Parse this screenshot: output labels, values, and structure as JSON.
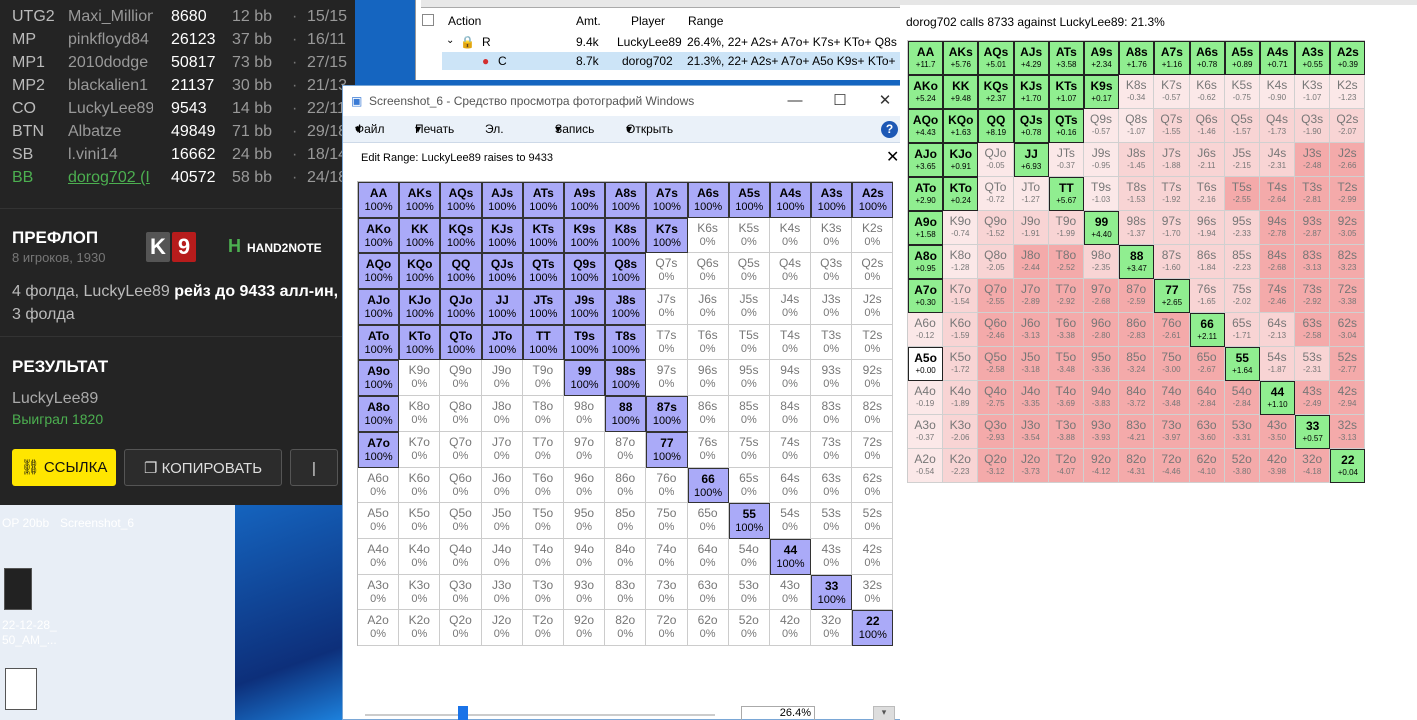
{
  "desktop": {
    "icons": [
      {
        "label": "OP 20bb"
      },
      {
        "label": "Screenshot_6"
      },
      {
        "label": "22-12-28_ 50_AM_..."
      }
    ]
  },
  "panel": {
    "seats": [
      {
        "pos": "UTG2",
        "name": "Maxi_Million",
        "stack": "8680",
        "bb": "12 bb",
        "cards": "15/15"
      },
      {
        "pos": "MP",
        "name": "pinkfloyd84",
        "stack": "26123",
        "bb": "37 bb",
        "cards": "16/11"
      },
      {
        "pos": "MP1",
        "name": "2010dodge",
        "stack": "50817",
        "bb": "73 bb",
        "cards": "27/15"
      },
      {
        "pos": "MP2",
        "name": "blackalien1",
        "stack": "21137",
        "bb": "30 bb",
        "cards": "21/13"
      },
      {
        "pos": "CO",
        "name": "LuckyLee89",
        "stack": "9543",
        "bb": "14 bb",
        "cards": "22/11"
      },
      {
        "pos": "BTN",
        "name": "Albatze",
        "stack": "49849",
        "bb": "71 bb",
        "cards": "29/18"
      },
      {
        "pos": "SB",
        "name": "l.vini14",
        "stack": "16662",
        "bb": "24 bb",
        "cards": "18/14"
      },
      {
        "pos": "BB",
        "name": "dorog702 (I",
        "stack": "40572",
        "bb": "58 bb",
        "cards": "24/18"
      }
    ],
    "dot": "·",
    "preflop_title": "ПРЕФЛОП",
    "preflop_sub": "8 игроков, 1930",
    "card1": "K",
    "card2": "9",
    "brand": "HAND2NOTE",
    "action_pre": "4 фолда, LuckyLee89 ",
    "action_bold": "рейз до 9433 алл-ин,",
    "action_post": "3 фолда",
    "result_title": "РЕЗУЛЬТАТ",
    "winner": "LuckyLee89",
    "won": "Выиграл 1820",
    "btn_link": "ССЫЛКА",
    "btn_copy": "КОПИРОВАТЬ",
    "btn_more": "|"
  },
  "history": {
    "headers": {
      "action": "Action",
      "amt": "Amt.",
      "player": "Player",
      "range": "Range"
    },
    "rows": [
      {
        "action": "R",
        "amt": "9.4k",
        "player": "LuckyLee89",
        "range": "26.4%, 22+ A2s+ A7o+ K7s+ KTo+ Q8s"
      },
      {
        "action": "C",
        "amt": "8.7k",
        "player": "dorog702",
        "range": "21.3%, 22+ A2s+ A7o+ A5o K9s+ KTo+"
      }
    ]
  },
  "viewer": {
    "title": "Screenshot_6 - Средство просмотра фотографий Windows",
    "menu": {
      "file": "Файл",
      "print": "Печать",
      "email": "Эл. почта",
      "record": "Запись",
      "open": "Открыть",
      "help": "?"
    },
    "edit_title": "Edit Range: LuckyLee89 raises to 9433",
    "close": "✕",
    "pct": "26.4%",
    "dd": "▾",
    "min": "—",
    "max": "☐",
    "xclose": "✕",
    "hands": [
      "AA",
      "AKs",
      "AQs",
      "AJs",
      "ATs",
      "A9s",
      "A8s",
      "A7s",
      "A6s",
      "A5s",
      "A4s",
      "A3s",
      "A2s",
      "AKo",
      "KK",
      "KQs",
      "KJs",
      "KTs",
      "K9s",
      "K8s",
      "K7s",
      "K6s",
      "K5s",
      "K4s",
      "K3s",
      "K2s",
      "AQo",
      "KQo",
      "QQ",
      "QJs",
      "QTs",
      "Q9s",
      "Q8s",
      "Q7s",
      "Q6s",
      "Q5s",
      "Q4s",
      "Q3s",
      "Q2s",
      "AJo",
      "KJo",
      "QJo",
      "JJ",
      "JTs",
      "J9s",
      "J8s",
      "J7s",
      "J6s",
      "J5s",
      "J4s",
      "J3s",
      "J2s",
      "ATo",
      "KTo",
      "QTo",
      "JTo",
      "TT",
      "T9s",
      "T8s",
      "T7s",
      "T6s",
      "T5s",
      "T4s",
      "T3s",
      "T2s",
      "A9o",
      "K9o",
      "Q9o",
      "J9o",
      "T9o",
      "99",
      "98s",
      "97s",
      "96s",
      "95s",
      "94s",
      "93s",
      "92s",
      "A8o",
      "K8o",
      "Q8o",
      "J8o",
      "T8o",
      "98o",
      "88",
      "87s",
      "86s",
      "85s",
      "84s",
      "83s",
      "82s",
      "A7o",
      "K7o",
      "Q7o",
      "J7o",
      "T7o",
      "97o",
      "87o",
      "77",
      "76s",
      "75s",
      "74s",
      "73s",
      "72s",
      "A6o",
      "K6o",
      "Q6o",
      "J6o",
      "T6o",
      "96o",
      "86o",
      "76o",
      "66",
      "65s",
      "64s",
      "63s",
      "62s",
      "A5o",
      "K5o",
      "Q5o",
      "J5o",
      "T5o",
      "95o",
      "85o",
      "75o",
      "65o",
      "55",
      "54s",
      "53s",
      "52s",
      "A4o",
      "K4o",
      "Q4o",
      "J4o",
      "T4o",
      "94o",
      "84o",
      "74o",
      "64o",
      "54o",
      "44",
      "43s",
      "42s",
      "A3o",
      "K3o",
      "Q3o",
      "J3o",
      "T3o",
      "93o",
      "83o",
      "73o",
      "63o",
      "53o",
      "43o",
      "33",
      "32s",
      "A2o",
      "K2o",
      "Q2o",
      "J2o",
      "T2o",
      "92o",
      "82o",
      "72o",
      "62o",
      "52o",
      "42o",
      "32o",
      "22"
    ],
    "selected": [
      "AA",
      "AKs",
      "AQs",
      "AJs",
      "ATs",
      "A9s",
      "A8s",
      "A7s",
      "A6s",
      "A5s",
      "A4s",
      "A3s",
      "A2s",
      "AKo",
      "KK",
      "KQs",
      "KJs",
      "KTs",
      "K9s",
      "K8s",
      "K7s",
      "AQo",
      "KQo",
      "QQ",
      "QJs",
      "QTs",
      "Q9s",
      "Q8s",
      "AJo",
      "KJo",
      "QJo",
      "JJ",
      "JTs",
      "J9s",
      "J8s",
      "ATo",
      "KTo",
      "QTo",
      "JTo",
      "TT",
      "T9s",
      "T8s",
      "A9o",
      "99",
      "98s",
      "A8o",
      "88",
      "87s",
      "A7o",
      "77",
      "66",
      "55",
      "44",
      "33",
      "22"
    ],
    "on_pct": "100%",
    "off_pct": "0%"
  },
  "equity": {
    "title": "dorog702 calls 8733 against LuckyLee89: 21.3%",
    "values": [
      "+11.7",
      "+5.76",
      "+5.01",
      "+4.29",
      "+3.58",
      "+2.34",
      "+1.76",
      "+1.16",
      "+0.78",
      "+0.89",
      "+0.71",
      "+0.55",
      "+0.39",
      "+5.24",
      "+9.48",
      "+2.37",
      "+1.70",
      "+1.07",
      "+0.17",
      "-0.34",
      "-0.57",
      "-0.62",
      "-0.75",
      "-0.90",
      "-1.07",
      "-1.23",
      "+4.43",
      "+1.63",
      "+8.19",
      "+0.78",
      "+0.16",
      "-0.57",
      "-1.07",
      "-1.55",
      "-1.46",
      "-1.57",
      "-1.73",
      "-1.90",
      "-2.07",
      "+3.65",
      "+0.91",
      "-0.05",
      "+6.93",
      "-0.37",
      "-0.95",
      "-1.45",
      "-1.88",
      "-2.11",
      "-2.15",
      "-2.31",
      "-2.48",
      "-2.66",
      "+2.90",
      "+0.24",
      "-0.72",
      "-1.27",
      "+5.67",
      "-1.03",
      "-1.53",
      "-1.92",
      "-2.16",
      "-2.55",
      "-2.64",
      "-2.81",
      "-2.99",
      "+1.58",
      "-0.74",
      "-1.52",
      "-1.91",
      "-1.99",
      "+4.40",
      "-1.37",
      "-1.70",
      "-1.94",
      "-2.33",
      "-2.78",
      "-2.87",
      "-3.05",
      "+0.95",
      "-1.28",
      "-2.05",
      "-2.44",
      "-2.52",
      "-2.35",
      "+3.47",
      "-1.60",
      "-1.84",
      "-2.23",
      "-2.68",
      "-3.13",
      "-3.23",
      "+0.30",
      "-1.54",
      "-2.55",
      "-2.89",
      "-2.92",
      "-2.68",
      "-2.59",
      "+2.65",
      "-1.65",
      "-2.02",
      "-2.46",
      "-2.92",
      "-3.38",
      "-0.12",
      "-1.59",
      "-2.46",
      "-3.13",
      "-3.38",
      "-2.80",
      "-2.83",
      "-2.61",
      "+2.11",
      "-1.71",
      "-2.13",
      "-2.58",
      "-3.04",
      "+0.00",
      "-1.72",
      "-2.58",
      "-3.18",
      "-3.48",
      "-3.36",
      "-3.24",
      "-3.00",
      "-2.67",
      "+1.64",
      "-1.87",
      "-2.31",
      "-2.77",
      "-0.19",
      "-1.89",
      "-2.75",
      "-3.35",
      "-3.69",
      "-3.83",
      "-3.72",
      "-3.48",
      "-2.84",
      "-2.84",
      "+1.10",
      "-2.49",
      "-2.94",
      "-0.37",
      "-2.06",
      "-2.93",
      "-3.54",
      "-3.88",
      "-3.93",
      "-4.21",
      "-3.97",
      "-3.60",
      "-3.31",
      "-3.50",
      "+0.57",
      "-3.13",
      "-0.54",
      "-2.23",
      "-3.12",
      "-3.73",
      "-4.07",
      "-4.12",
      "-4.31",
      "-4.46",
      "-4.10",
      "-3.80",
      "-3.98",
      "-4.18",
      "+0.04"
    ],
    "selected": [
      "AA",
      "AKs",
      "AQs",
      "AJs",
      "ATs",
      "A9s",
      "A8s",
      "A7s",
      "A6s",
      "A5s",
      "A4s",
      "A3s",
      "A2s",
      "AKo",
      "KK",
      "KQs",
      "KJs",
      "KTs",
      "K9s",
      "AQo",
      "KQo",
      "QQ",
      "QJs",
      "QTs",
      "AJo",
      "KJo",
      "JJ",
      "ATo",
      "KTo",
      "TT",
      "A9o",
      "99",
      "A8o",
      "88",
      "A7o",
      "77",
      "66",
      "A5o",
      "55",
      "44",
      "33",
      "22"
    ],
    "colors": {
      "pos": "#90ee90",
      "neg": "#f4aaaa",
      "on": "#aaaaf8"
    }
  }
}
